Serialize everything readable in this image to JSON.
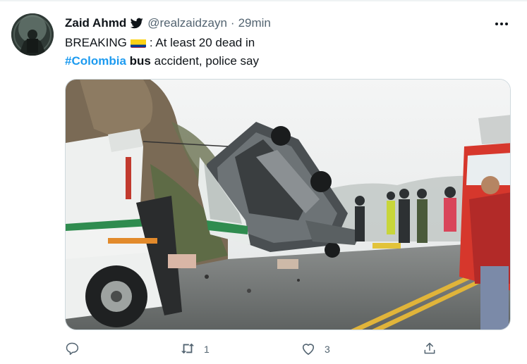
{
  "tweet": {
    "author_name": "Zaid Ahmd",
    "author_handle": "@realzaidzayn",
    "separator": "·",
    "timestamp": "29min",
    "text_line1_pre": "BREAKING",
    "text_line1_post": ": At least 20 dead in",
    "hashtag": "#Colombia",
    "bold_word": "bus",
    "text_line2_post": "accident, police say",
    "flag": "colombia-flag-emoji"
  },
  "actions": {
    "reply_count": "",
    "retweet_count": "1",
    "like_count": "3",
    "share_count": ""
  },
  "colors": {
    "link": "#1d9bf0",
    "secondary_text": "#536471",
    "primary_text": "#0f1419"
  },
  "icons": [
    "verified-icon",
    "more-icon",
    "reply-icon",
    "retweet-icon",
    "like-icon",
    "share-icon"
  ]
}
